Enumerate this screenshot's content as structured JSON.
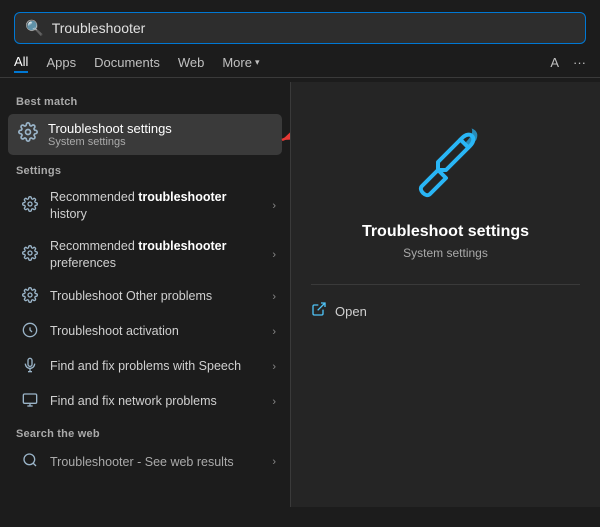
{
  "search": {
    "value": "Troubleshooter",
    "placeholder": "Troubleshooter"
  },
  "tabs": [
    {
      "label": "All",
      "active": true
    },
    {
      "label": "Apps",
      "active": false
    },
    {
      "label": "Documents",
      "active": false
    },
    {
      "label": "Web",
      "active": false
    },
    {
      "label": "More",
      "active": false
    }
  ],
  "tab_extras": {
    "font_label": "A",
    "dots_label": "···"
  },
  "best_match": {
    "section_label": "Best match",
    "item": {
      "title": "Troubleshoot settings",
      "subtitle": "System settings"
    }
  },
  "settings": {
    "section_label": "Settings",
    "items": [
      {
        "text_plain": "Recommended ",
        "text_bold": "troubleshooter",
        "text_after": " history",
        "icon": "⚙"
      },
      {
        "text_plain": "Recommended ",
        "text_bold": "troubleshooter",
        "text_after": " preferences",
        "icon": "⚙"
      },
      {
        "text_plain": "Troubleshoot Other problems",
        "text_bold": "",
        "text_after": "",
        "icon": "⚙"
      },
      {
        "text_plain": "Troubleshoot activation",
        "text_bold": "",
        "text_after": "",
        "icon": "◎"
      },
      {
        "text_plain": "Find and fix problems with Speech",
        "text_bold": "",
        "text_after": "",
        "icon": "🎤"
      },
      {
        "text_plain": "Find and fix network problems",
        "text_bold": "",
        "text_after": "",
        "icon": "🖥"
      }
    ]
  },
  "search_web": {
    "section_label": "Search the web",
    "item_text": "Troubleshooter",
    "item_suffix": " - See web results"
  },
  "right_panel": {
    "title": "Troubleshoot settings",
    "subtitle": "System settings",
    "open_label": "Open"
  }
}
